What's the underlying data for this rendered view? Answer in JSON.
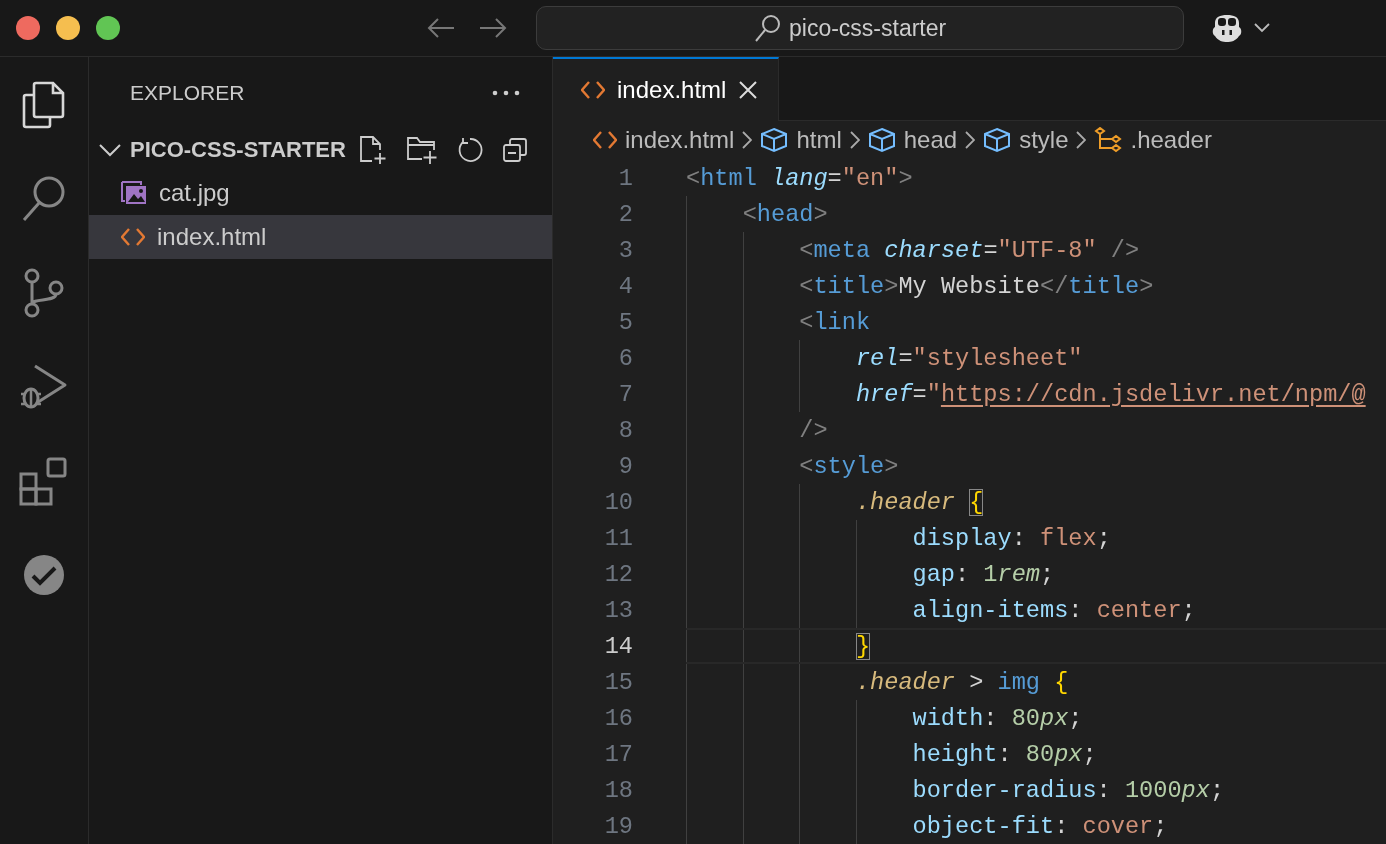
{
  "command_center": {
    "label": "pico-css-starter"
  },
  "activity_bar": [
    {
      "kind": "files",
      "selected": true
    },
    {
      "kind": "search",
      "selected": false
    },
    {
      "kind": "source-control",
      "selected": false
    },
    {
      "kind": "run-debug",
      "selected": false
    },
    {
      "kind": "extensions",
      "selected": false
    },
    {
      "kind": "testing",
      "selected": false
    }
  ],
  "sidebar": {
    "title": "EXPLORER",
    "folder": {
      "name": "PICO-CSS-STARTER",
      "expanded": true,
      "files": [
        {
          "name": "cat.jpg",
          "kind": "image",
          "selected": false
        },
        {
          "name": "index.html",
          "kind": "html",
          "selected": true
        }
      ]
    }
  },
  "tabs": [
    {
      "label": "index.html",
      "kind": "html",
      "selected": true
    }
  ],
  "breadcrumbs": [
    {
      "label": "index.html",
      "kind": "html"
    },
    {
      "label": "html",
      "kind": "element"
    },
    {
      "label": "head",
      "kind": "element"
    },
    {
      "label": "style",
      "kind": "element"
    },
    {
      "label": ".header",
      "kind": "rule"
    }
  ],
  "editor": {
    "lines": [
      {
        "number": "1",
        "current": false,
        "tokens": [
          {
            "kind": "p",
            "text": "<"
          },
          {
            "kind": "tag",
            "text": "html "
          },
          {
            "kind": "attr",
            "text": "lang"
          },
          {
            "kind": "txt",
            "text": "="
          },
          {
            "kind": "str",
            "text": "\"en\""
          },
          {
            "kind": "p",
            "text": ">"
          }
        ]
      },
      {
        "number": "2",
        "current": false,
        "tokens": [
          {
            "kind": "p",
            "text": "    <"
          },
          {
            "kind": "tag",
            "text": "head"
          },
          {
            "kind": "p",
            "text": ">"
          }
        ]
      },
      {
        "number": "3",
        "current": false,
        "tokens": [
          {
            "kind": "p",
            "text": "        <"
          },
          {
            "kind": "tag",
            "text": "meta "
          },
          {
            "kind": "attr",
            "text": "charset"
          },
          {
            "kind": "txt",
            "text": "="
          },
          {
            "kind": "str",
            "text": "\"UTF-8\""
          },
          {
            "kind": "p",
            "text": " />"
          }
        ]
      },
      {
        "number": "4",
        "current": false,
        "tokens": [
          {
            "kind": "p",
            "text": "        <"
          },
          {
            "kind": "tag",
            "text": "title"
          },
          {
            "kind": "p",
            "text": ">"
          },
          {
            "kind": "txt",
            "text": "My Website"
          },
          {
            "kind": "p",
            "text": "</"
          },
          {
            "kind": "tag",
            "text": "title"
          },
          {
            "kind": "p",
            "text": ">"
          }
        ]
      },
      {
        "number": "5",
        "current": false,
        "tokens": [
          {
            "kind": "p",
            "text": "        <"
          },
          {
            "kind": "tag",
            "text": "link"
          }
        ]
      },
      {
        "number": "6",
        "current": false,
        "tokens": [
          {
            "kind": "attr",
            "text": "            rel"
          },
          {
            "kind": "txt",
            "text": "="
          },
          {
            "kind": "str",
            "text": "\"stylesheet\""
          }
        ]
      },
      {
        "number": "7",
        "current": false,
        "tokens": [
          {
            "kind": "attr",
            "text": "            href"
          },
          {
            "kind": "txt",
            "text": "="
          },
          {
            "kind": "str",
            "text": "\""
          },
          {
            "kind": "url",
            "text": "https://cdn.jsdelivr.net/npm/@"
          }
        ]
      },
      {
        "number": "8",
        "current": false,
        "tokens": [
          {
            "kind": "p",
            "text": "        />"
          }
        ]
      },
      {
        "number": "9",
        "current": false,
        "tokens": [
          {
            "kind": "p",
            "text": "        <"
          },
          {
            "kind": "tag",
            "text": "style"
          },
          {
            "kind": "p",
            "text": ">"
          }
        ]
      },
      {
        "number": "10",
        "current": false,
        "tokens": [
          {
            "kind": "sel",
            "text": "            .header "
          },
          {
            "kind": "brace",
            "text": "{",
            "matched": true
          }
        ]
      },
      {
        "number": "11",
        "current": false,
        "tokens": [
          {
            "kind": "prop",
            "text": "                display"
          },
          {
            "kind": "txt",
            "text": ": "
          },
          {
            "kind": "val",
            "text": "flex"
          },
          {
            "kind": "txt",
            "text": ";"
          }
        ]
      },
      {
        "number": "12",
        "current": false,
        "tokens": [
          {
            "kind": "prop",
            "text": "                gap"
          },
          {
            "kind": "txt",
            "text": ": "
          },
          {
            "kind": "num",
            "text": "1"
          },
          {
            "kind": "unit",
            "text": "rem"
          },
          {
            "kind": "txt",
            "text": ";"
          }
        ]
      },
      {
        "number": "13",
        "current": false,
        "tokens": [
          {
            "kind": "prop",
            "text": "                align-items"
          },
          {
            "kind": "txt",
            "text": ": "
          },
          {
            "kind": "val",
            "text": "center"
          },
          {
            "kind": "txt",
            "text": ";"
          }
        ]
      },
      {
        "number": "14",
        "current": true,
        "tokens": [
          {
            "kind": "brace",
            "text": "            }",
            "matched": true
          }
        ]
      },
      {
        "number": "15",
        "current": false,
        "tokens": [
          {
            "kind": "sel",
            "text": "            .header "
          },
          {
            "kind": "txt",
            "text": "> "
          },
          {
            "kind": "tag",
            "text": "img "
          },
          {
            "kind": "brace",
            "text": "{",
            "matched": false
          }
        ]
      },
      {
        "number": "16",
        "current": false,
        "tokens": [
          {
            "kind": "prop",
            "text": "                width"
          },
          {
            "kind": "txt",
            "text": ": "
          },
          {
            "kind": "num",
            "text": "80"
          },
          {
            "kind": "unit",
            "text": "px"
          },
          {
            "kind": "txt",
            "text": ";"
          }
        ]
      },
      {
        "number": "17",
        "current": false,
        "tokens": [
          {
            "kind": "prop",
            "text": "                height"
          },
          {
            "kind": "txt",
            "text": ": "
          },
          {
            "kind": "num",
            "text": "80"
          },
          {
            "kind": "unit",
            "text": "px"
          },
          {
            "kind": "txt",
            "text": ";"
          }
        ]
      },
      {
        "number": "18",
        "current": false,
        "tokens": [
          {
            "kind": "prop",
            "text": "                border-radius"
          },
          {
            "kind": "txt",
            "text": ": "
          },
          {
            "kind": "num",
            "text": "1000"
          },
          {
            "kind": "unit",
            "text": "px"
          },
          {
            "kind": "txt",
            "text": ";"
          }
        ]
      },
      {
        "number": "19",
        "current": false,
        "tokens": [
          {
            "kind": "prop",
            "text": "                object-fit"
          },
          {
            "kind": "txt",
            "text": ": "
          },
          {
            "kind": "val",
            "text": "cover"
          },
          {
            "kind": "txt",
            "text": ";"
          }
        ]
      }
    ]
  }
}
